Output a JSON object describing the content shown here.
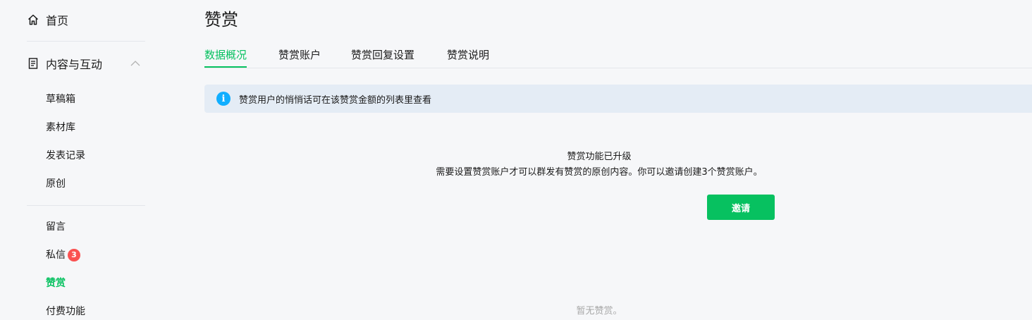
{
  "sidebar": {
    "home_label": "首页",
    "group_label": "内容与互动",
    "items": [
      {
        "label": "草稿箱"
      },
      {
        "label": "素材库"
      },
      {
        "label": "发表记录"
      },
      {
        "label": "原创"
      },
      {
        "label": "留言"
      },
      {
        "label": "私信",
        "badge": "3"
      },
      {
        "label": "赞赏",
        "active": true
      },
      {
        "label": "付费功能"
      }
    ]
  },
  "page": {
    "title": "赞赏",
    "tabs": [
      {
        "label": "数据概况",
        "active": true
      },
      {
        "label": "赞赏账户"
      },
      {
        "label": "赞赏回复设置"
      },
      {
        "label": "赞赏说明"
      }
    ],
    "notice": "赞赏用户的悄悄话可在该赞赏金额的列表里查看",
    "empty_title": "赞赏功能已升级",
    "empty_desc": "需要设置赞赏账户才可以群发有赞赏的原创内容。你可以邀请创建3个赞赏账户。",
    "invite_button": "邀请",
    "empty_foot": "暂无赞赏。"
  },
  "colors": {
    "accent": "#07c160",
    "badge": "#fa5151",
    "info": "#10aeff",
    "notice_bg": "#e4ecf5"
  },
  "icons": {
    "home": "home-icon",
    "content": "document-icon",
    "collapse": "chevron-up-icon",
    "info": "info-icon"
  }
}
